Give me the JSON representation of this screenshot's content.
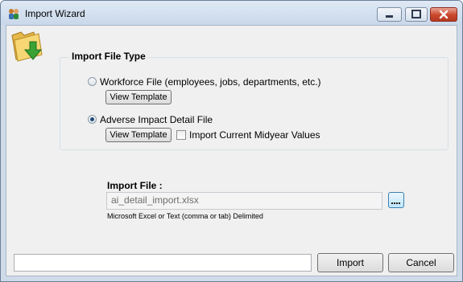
{
  "window": {
    "title": "Import Wizard",
    "icons": {
      "app": "people-app-icon",
      "minimize": "minimize-icon",
      "maximize": "maximize-icon",
      "close": "close-icon"
    }
  },
  "header": {
    "icon": "folder-download-icon"
  },
  "file_type": {
    "title": "Import File Type",
    "options": [
      {
        "label": "Workforce File (employees, jobs, departments, etc.)",
        "selected": false,
        "template_label": "View Template"
      },
      {
        "label": "Adverse Impact Detail File",
        "selected": true,
        "template_label": "View Template"
      }
    ],
    "midyear_checkbox": {
      "label": "Import Current Midyear Values",
      "checked": false
    }
  },
  "import_file": {
    "label": "Import File :",
    "value": "ai_detail_import.xlsx",
    "hint": "Microsoft Excel or Text (comma or tab) Delimited",
    "browse_label": "...."
  },
  "footer": {
    "status_text": "",
    "import_label": "Import",
    "cancel_label": "Cancel"
  },
  "colors": {
    "accent": "#3c7fb1",
    "close": "#c9462b",
    "folder": "#f2c94c",
    "arrow": "#3aa235"
  }
}
